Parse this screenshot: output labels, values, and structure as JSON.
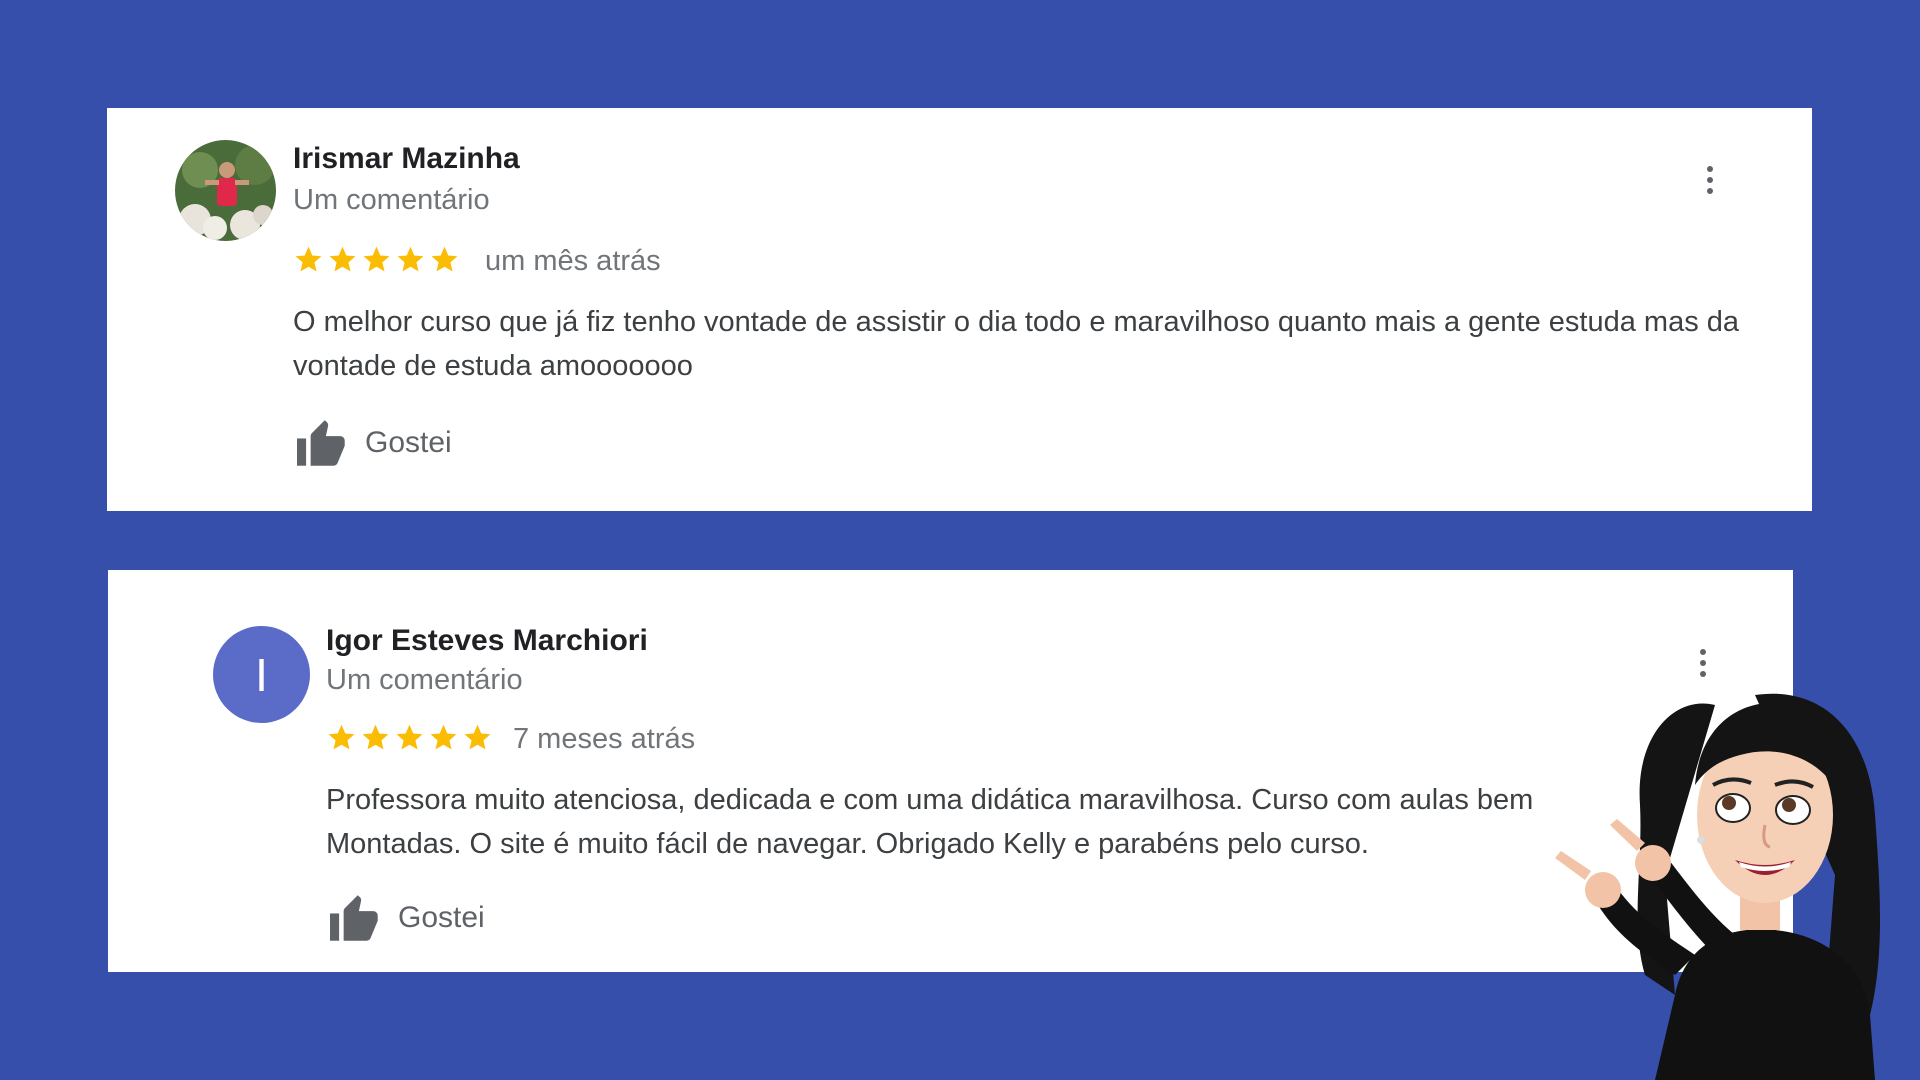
{
  "colors": {
    "background": "#364fab",
    "card": "#ffffff",
    "star": "#fbbc04",
    "avatar_letter_bg": "#5b6bc8"
  },
  "reviews": [
    {
      "name": "Irismar Mazinha",
      "subtitle": "Um comentário",
      "rating": 5,
      "date": "um mês atrás",
      "text": "O melhor curso que já fiz tenho vontade de assistir o dia todo e maravilhoso quanto mais a gente estuda mas da vontade de estuda amooooooo",
      "like_label": "Gostei",
      "avatar": "photo"
    },
    {
      "name": "Igor Esteves Marchiori",
      "subtitle": "Um comentário",
      "rating": 5,
      "date": "7 meses atrás",
      "text": "Professora muito atenciosa, dedicada e com uma didática maravilhosa. Curso com aulas bem Montadas. O site é muito fácil de navegar. Obrigado Kelly e parabéns pelo curso.",
      "like_label": "Gostei",
      "avatar_letter": "I"
    }
  ],
  "icons": {
    "like": "thumbs-up-icon",
    "more": "more-vert-icon",
    "star": "star-icon"
  }
}
